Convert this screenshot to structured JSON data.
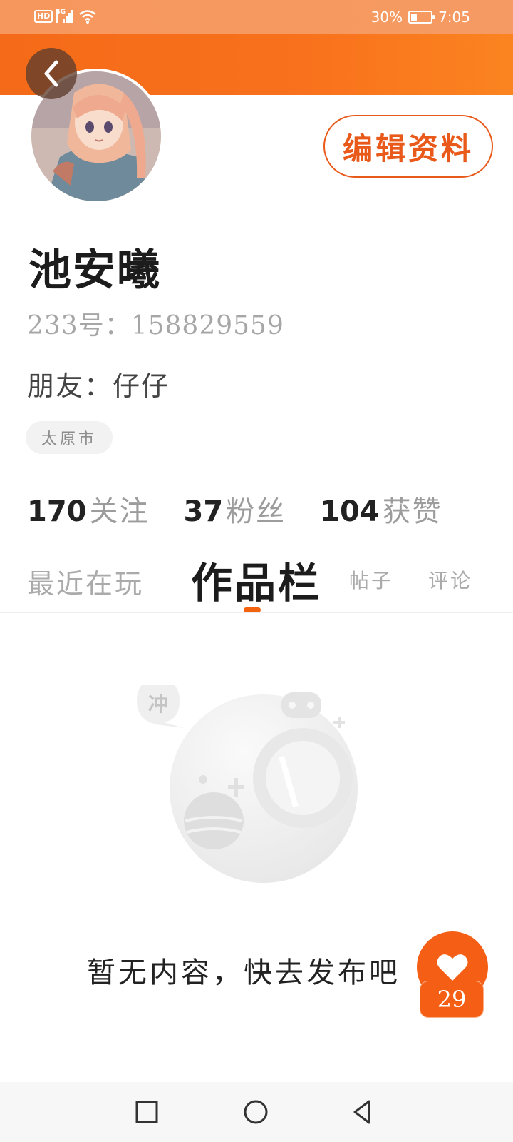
{
  "status_bar": {
    "left_icons": [
      "hd-icon",
      "signal-4g-icon",
      "wifi-icon"
    ],
    "hd_label": "HD",
    "network_label": "4G",
    "battery_percent": "30%",
    "battery_level": 0.3,
    "time": "7:05"
  },
  "header": {
    "back_icon": "chevron-left-icon",
    "avatar_icon": "avatar-anime-character",
    "edit_profile_label": "编辑资料"
  },
  "profile": {
    "name": "池安曦",
    "id_line": "233号：158829559",
    "friend_line": "朋友：仔仔",
    "location": "太原市"
  },
  "stats": [
    {
      "value": "170",
      "label": "关注"
    },
    {
      "value": "37",
      "label": "粉丝"
    },
    {
      "value": "104",
      "label": "获赞"
    }
  ],
  "tabs": [
    {
      "label": "最近在玩",
      "active": false
    },
    {
      "label": "作品栏",
      "active": true
    },
    {
      "label": "帖子",
      "active": false
    },
    {
      "label": "评论",
      "active": false
    }
  ],
  "empty_state": {
    "bubble_text": "冲",
    "message": "暂无内容，快去发布吧"
  },
  "like_widget": {
    "icon": "heart-icon",
    "count": "29"
  },
  "colors": {
    "accent": "#f46a18",
    "status_bar": "#f6985e",
    "muted_text": "#9c9c9c"
  },
  "nav_bar": {
    "icons": [
      "square-recents-icon",
      "circle-home-icon",
      "triangle-back-icon"
    ]
  }
}
